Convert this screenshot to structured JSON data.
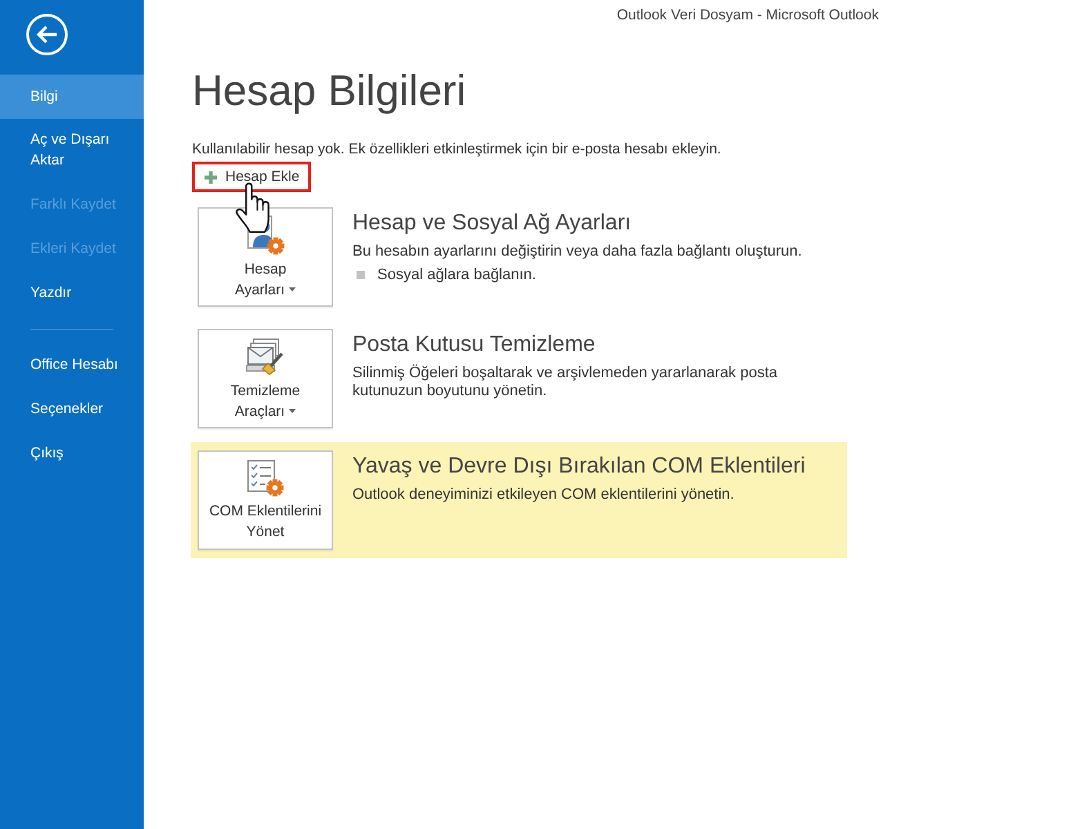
{
  "window": {
    "title": "Outlook Veri Dosyam - Microsoft Outlook"
  },
  "sidebar": {
    "groups": [
      {
        "items": [
          {
            "label": "Bilgi",
            "selected": true,
            "disabled": false
          },
          {
            "label": "Aç ve Dışarı\nAktar",
            "selected": false,
            "disabled": false
          },
          {
            "label": "Farklı Kaydet",
            "selected": false,
            "disabled": true
          },
          {
            "label": "Ekleri Kaydet",
            "selected": false,
            "disabled": true
          },
          {
            "label": "Yazdır",
            "selected": false,
            "disabled": false
          }
        ]
      },
      {
        "items": [
          {
            "label": "Office Hesabı",
            "selected": false,
            "disabled": false
          },
          {
            "label": "Seçenekler",
            "selected": false,
            "disabled": false
          },
          {
            "label": "Çıkış",
            "selected": false,
            "disabled": false
          }
        ]
      }
    ]
  },
  "page": {
    "title": "Hesap Bilgileri",
    "description": "Kullanılabilir hesap yok. Ek özellikleri etkinleştirmek için bir e-posta hesabı ekleyin.",
    "add_account_button": {
      "label": "Hesap Ekle",
      "highlighted": true,
      "pointer_over": true
    }
  },
  "sections": [
    {
      "kind": "account_settings",
      "button": {
        "label": "Hesap\nAyarları",
        "dropdown": true
      },
      "title": "Hesap ve Sosyal Ağ Ayarları",
      "description": "Bu hesabın ayarlarını değiştirin veya daha fazla bağlantı oluşturun.",
      "bullets": [
        "Sosyal ağlara bağlanın."
      ],
      "highlighted": false
    },
    {
      "kind": "cleanup",
      "button": {
        "label": "Temizleme\nAraçları",
        "dropdown": true
      },
      "title": "Posta Kutusu Temizleme",
      "description": "Silinmiş Öğeleri boşaltarak ve arşivlemeden yararlanarak posta kutunuzun boyutunu yönetin.",
      "highlighted": false
    },
    {
      "kind": "com_addins",
      "button": {
        "label": "COM Eklentilerini\nYönet",
        "dropdown": false
      },
      "title": "Yavaş ve Devre Dışı Bırakılan COM Eklentileri",
      "description": "Outlook deneyiminizi etkileyen COM eklentilerini yönetin.",
      "highlighted": true
    }
  ]
}
